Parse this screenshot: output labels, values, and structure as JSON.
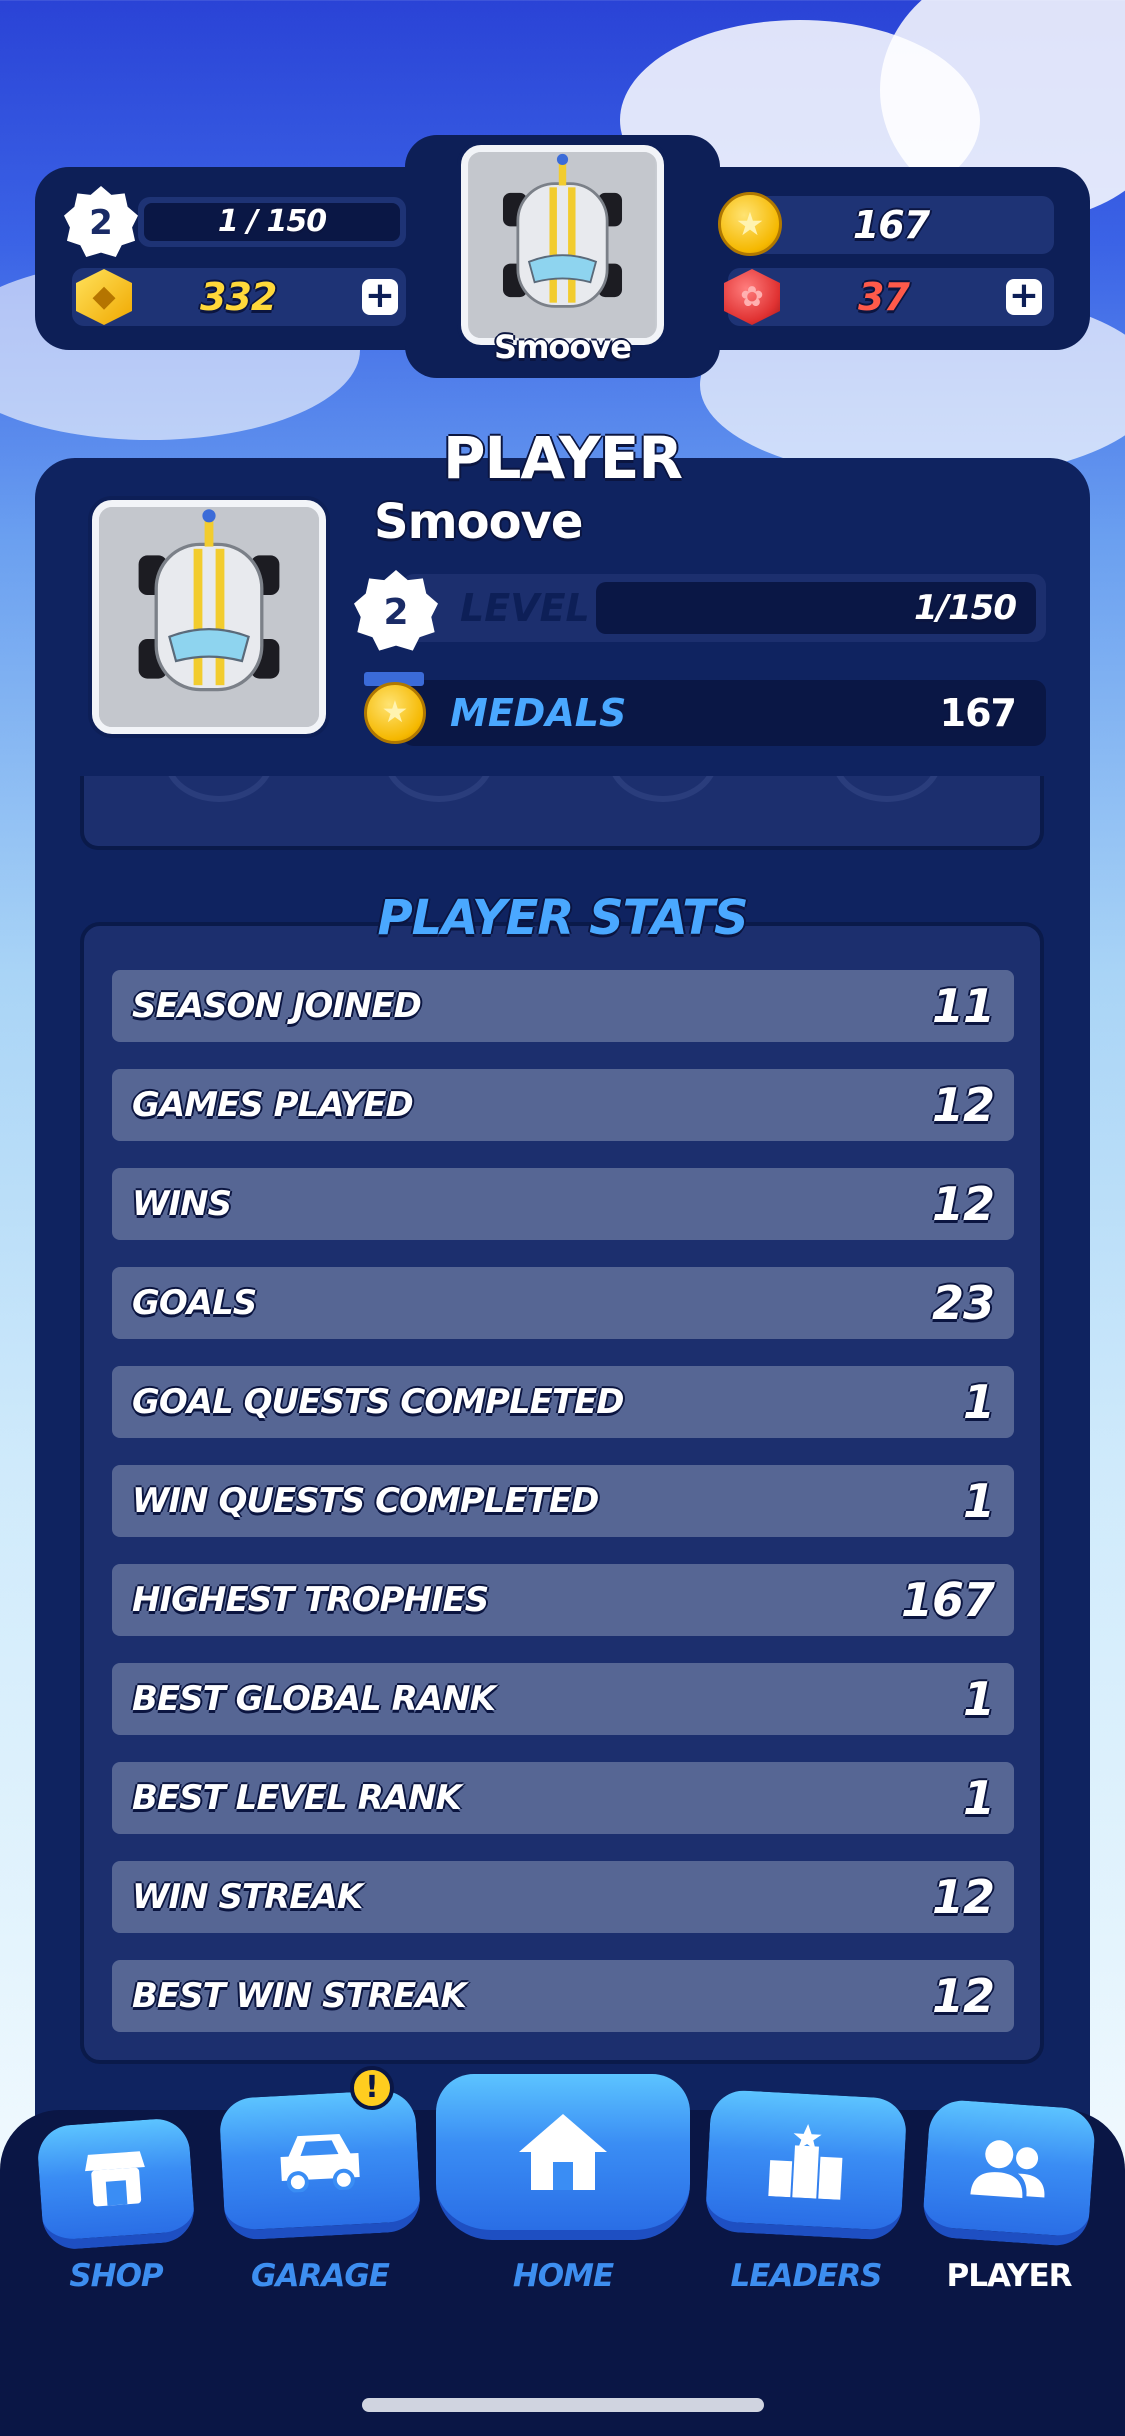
{
  "header": {
    "level": "2",
    "xp": "1 / 150",
    "gems": "332",
    "medals": "167",
    "rubies": "37",
    "player_name": "Smoove"
  },
  "player_panel": {
    "title": "PLAYER",
    "name": "Smoove",
    "level_badge": "2",
    "level_label": "LEVEL",
    "level_progress": "1/150",
    "medals_label": "MEDALS",
    "medals_value": "167"
  },
  "stats": {
    "title": "PLAYER STATS",
    "rows": [
      {
        "label": "SEASON JOINED",
        "value": "11"
      },
      {
        "label": "GAMES PLAYED",
        "value": "12"
      },
      {
        "label": "WINS",
        "value": "12"
      },
      {
        "label": "GOALS",
        "value": "23"
      },
      {
        "label": "GOAL QUESTS COMPLETED",
        "value": "1"
      },
      {
        "label": "WIN QUESTS COMPLETED",
        "value": "1"
      },
      {
        "label": "HIGHEST TROPHIES",
        "value": "167"
      },
      {
        "label": "BEST GLOBAL RANK",
        "value": "1"
      },
      {
        "label": "BEST LEVEL RANK",
        "value": "1"
      },
      {
        "label": "WIN STREAK",
        "value": "12"
      },
      {
        "label": "BEST WIN STREAK",
        "value": "12"
      }
    ]
  },
  "nav": {
    "shop": "SHOP",
    "garage": "GARAGE",
    "garage_badge": "!",
    "home": "HOME",
    "leaders": "LEADERS",
    "player": "PLAYER"
  },
  "icons": {
    "level": "level-badge-icon",
    "gem": "gem-icon",
    "medal": "medal-icon",
    "ruby": "ruby-icon",
    "shop": "shop-icon",
    "garage": "car-icon",
    "home": "home-icon",
    "leaders": "podium-icon",
    "player": "people-icon"
  },
  "colors": {
    "panel": "#0f2360",
    "row": "#566694",
    "accent_blue": "#3d8ef0",
    "gems": "#ffd83a",
    "rubies": "#ff5a4a"
  }
}
